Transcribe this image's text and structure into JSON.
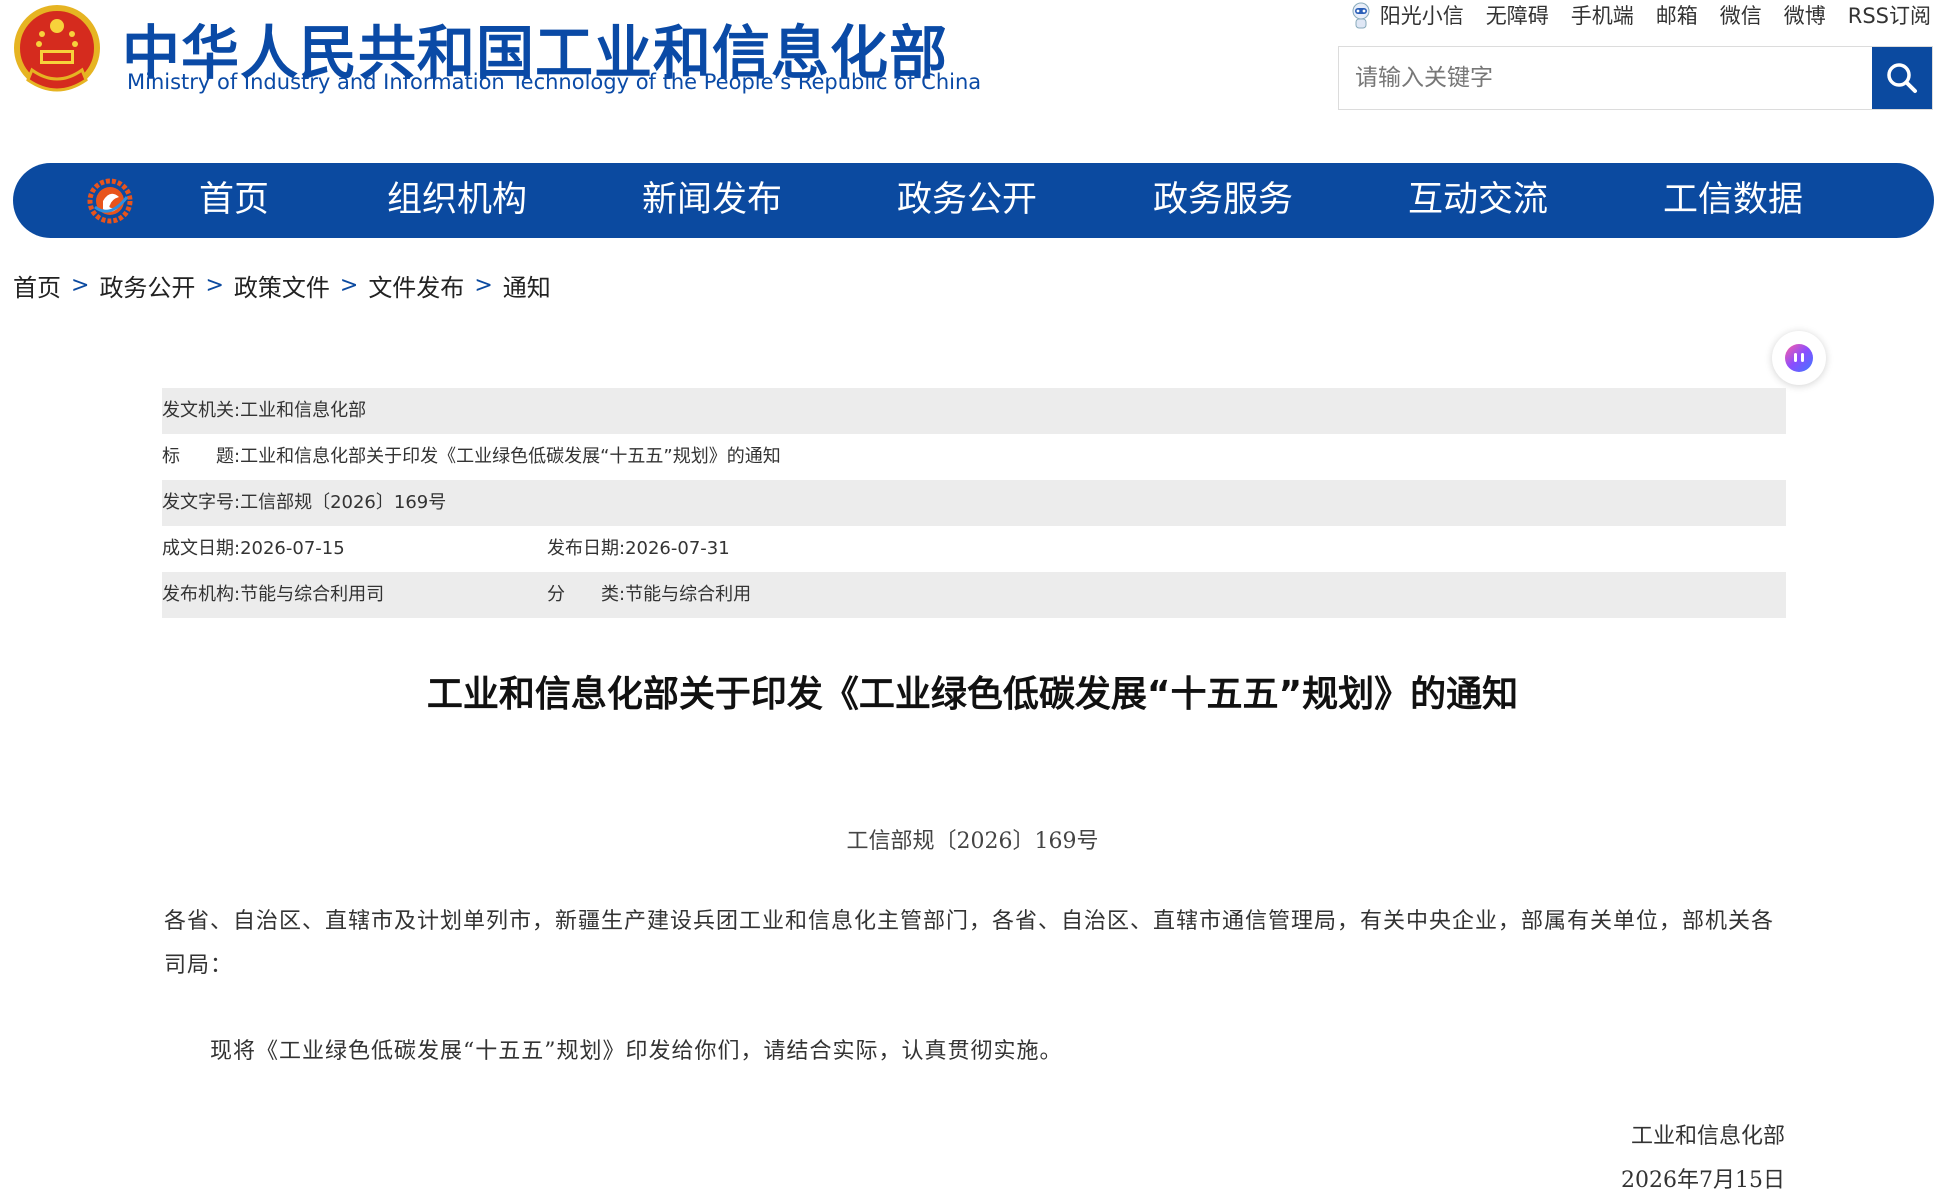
{
  "header": {
    "title_cn": "中华人民共和国工业和信息化部",
    "title_en": "Ministry of Industry and Information Technology of the People’s Republic of China"
  },
  "toplinks": [
    "阳光小信",
    "无障碍",
    "手机端",
    "邮箱",
    "微信",
    "微博",
    "RSS订阅"
  ],
  "search": {
    "placeholder": "请输入关键字"
  },
  "nav": {
    "items": [
      "首页",
      "组织机构",
      "新闻发布",
      "政务公开",
      "政务服务",
      "互动交流",
      "工信数据"
    ]
  },
  "breadcrumb": {
    "items": [
      "首页",
      "政务公开",
      "政策文件",
      "文件发布",
      "通知"
    ],
    "separator": ">"
  },
  "info": {
    "issuer_label": "发文机关:",
    "issuer": "工业和信息化部",
    "title_label": "标　　题:",
    "title": "工业和信息化部关于印发《工业绿色低碳发展“十五五”规划》的通知",
    "docno_label": "发文字号:",
    "docno": "工信部规〔2026〕169号",
    "created_label": "成文日期:",
    "created": "2026-07-15",
    "published_label": "发布日期:",
    "published": "2026-07-31",
    "agency_label": "发布机构:",
    "agency": "节能与综合利用司",
    "category_label": "分　　类:",
    "category": "节能与综合利用"
  },
  "article": {
    "title": "工业和信息化部关于印发《工业绿色低碳发展“十五五”规划》的通知",
    "docno": "工信部规〔2026〕169号",
    "addressee": "各省、自治区、直辖市及计划单列市，新疆生产建设兵团工业和信息化主管部门，各省、自治区、直辖市通信管理局，有关中央企业，部属有关单位，部机关各司局：",
    "body": "现将《工业绿色低碳发展“十五五”规划》印发给你们，请结合实际，认真贯彻实施。",
    "signature": "工业和信息化部",
    "date": "2026年7月15日"
  },
  "colors": {
    "brand_blue": "#0b4aa0",
    "title_blue": "#0a4aa6",
    "row_grey": "#ececec"
  }
}
